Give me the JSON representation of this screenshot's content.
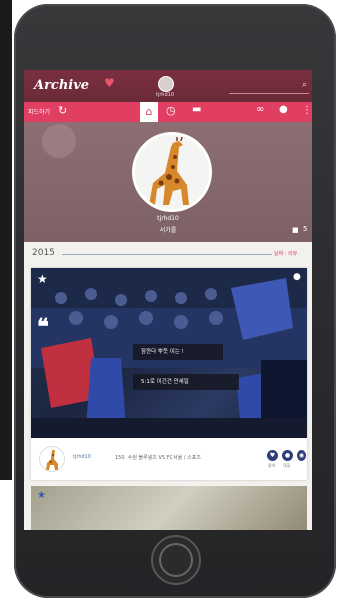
{
  "header": {
    "logo_text": "Archive",
    "logo_mark": "♥",
    "mini_name": "tjrhd10",
    "search_icon": "⌕"
  },
  "tabs": {
    "left_label": "피드하기",
    "left_icon": "↻",
    "home_icon": "⌂",
    "clock_icon": "◷",
    "chat_icon": "▬",
    "link_icon": "∞",
    "bulb_icon": "●",
    "more_icon": "⋮"
  },
  "profile": {
    "name": "tjrhd10",
    "subtitle": "서가를",
    "folder_icon": "■",
    "folder_count": "5"
  },
  "timeline": {
    "year": "2015",
    "right_label": "날짜 · 리뷰"
  },
  "card": {
    "star": "★",
    "quote": "❝",
    "corner": "●",
    "bubble_1": "잠깐다 뿌듯 이는 !",
    "bubble_2": "5:1로 이긴건 만세일",
    "user": "tjrhd10",
    "text": "150. 수원 블루윙즈 VS FC서울 / 스포츠",
    "btn_1": "♥",
    "btn_2": "●",
    "btn_3": "◉",
    "btn_1_label": "좋아",
    "btn_2_label": "댓글"
  },
  "card2": {
    "star": "★"
  }
}
